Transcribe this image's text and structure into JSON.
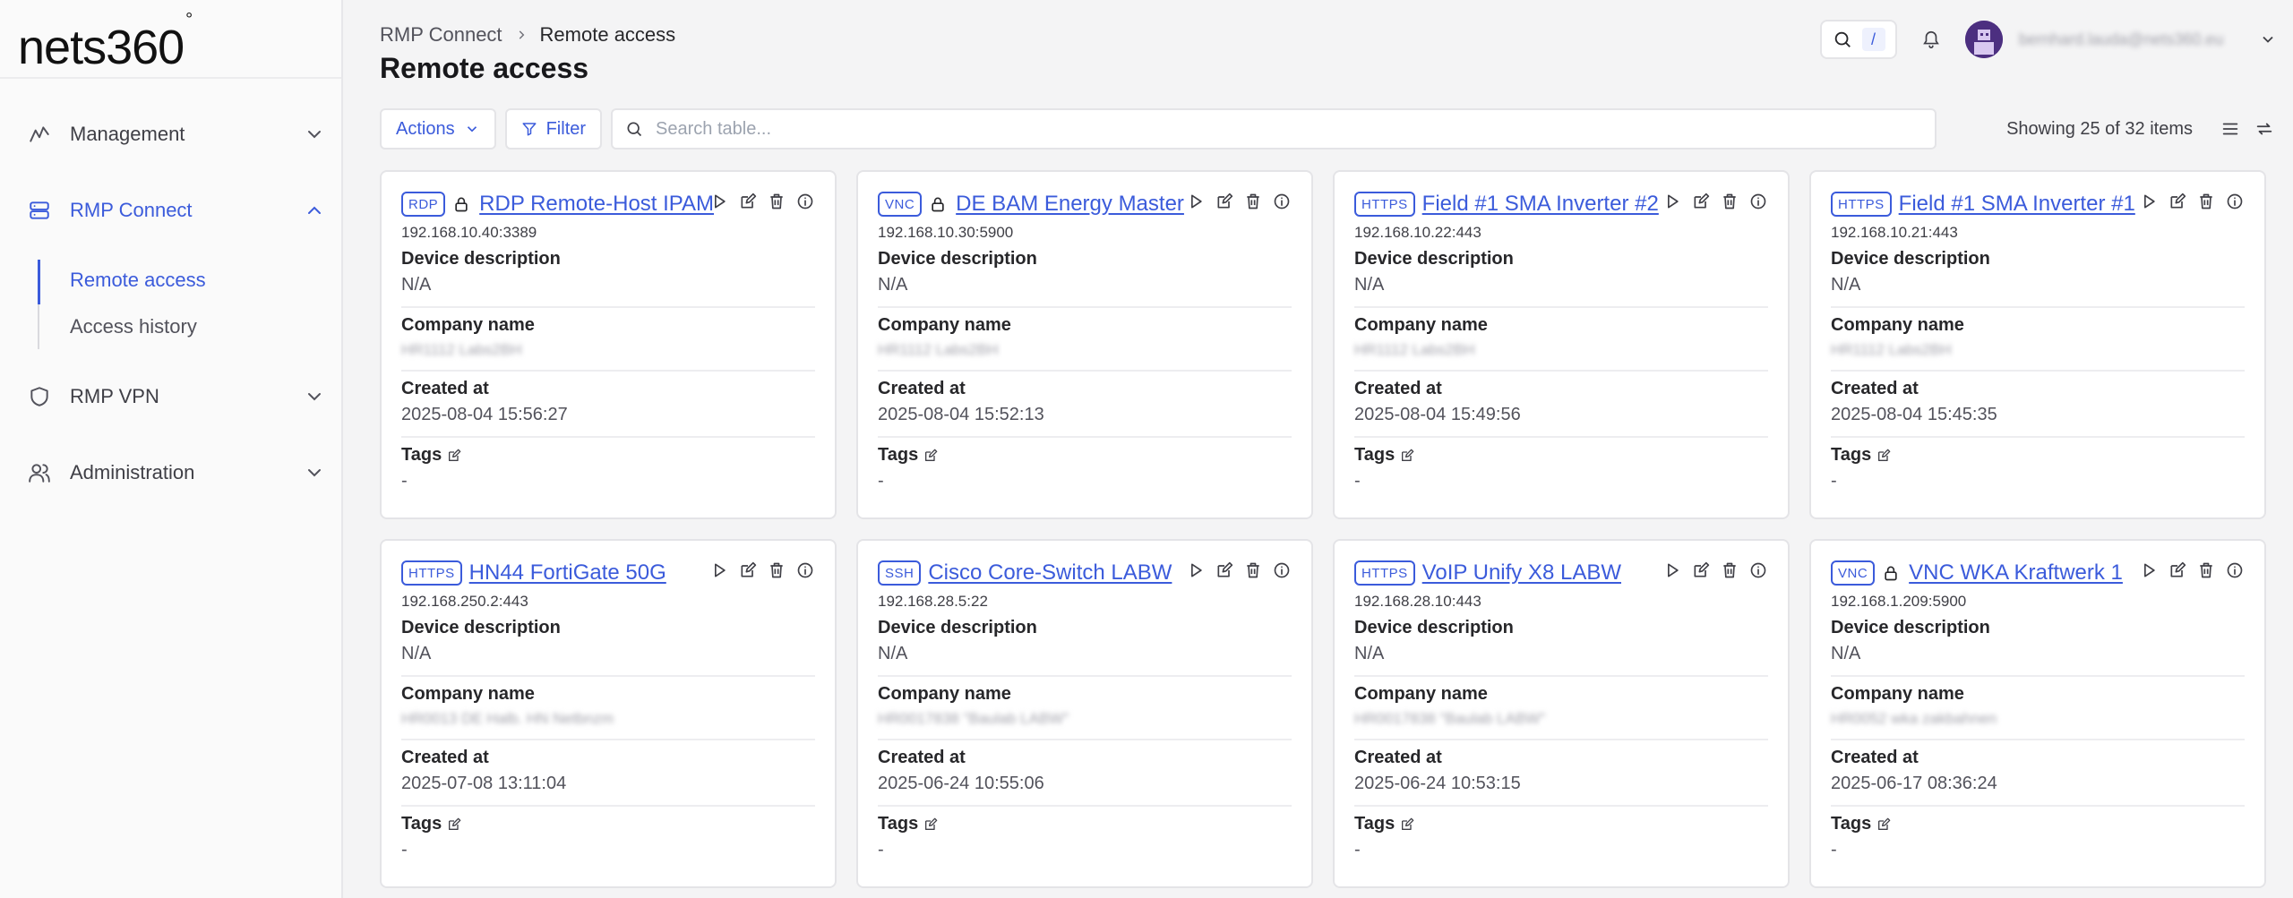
{
  "brand": {
    "logo": "nets360",
    "logo_mark": "°"
  },
  "sidebar": {
    "items": [
      {
        "label": "Management"
      },
      {
        "label": "RMP Connect"
      },
      {
        "label": "RMP VPN"
      },
      {
        "label": "Administration"
      }
    ],
    "subitems": [
      {
        "label": "Remote access"
      },
      {
        "label": "Access history"
      }
    ]
  },
  "breadcrumb": {
    "parent": "RMP Connect",
    "current": "Remote access"
  },
  "page": {
    "title": "Remote access"
  },
  "header": {
    "shortcut_key": "/",
    "user_email": "bernhard.lauda@nets360.eu"
  },
  "toolbar": {
    "actions_label": "Actions",
    "filter_label": "Filter",
    "search_placeholder": "Search table...",
    "showing_text": "Showing 25 of 32 items"
  },
  "labels": {
    "device_description": "Device description",
    "company_name": "Company name",
    "created_at": "Created at",
    "tags": "Tags"
  },
  "colors": {
    "accent": "#3b5bdb",
    "card_border": "#e4e4e7",
    "background": "#f4f4f5"
  },
  "cards": [
    {
      "protocol": "RDP",
      "locked": true,
      "title": "RDP Remote-Host IPAM",
      "address": "192.168.10.40:3389",
      "description": "N/A",
      "company": "HR1112 Labs2BH",
      "created": "2025-08-04 15:56:27",
      "tags": "-"
    },
    {
      "protocol": "VNC",
      "locked": true,
      "title": "DE BAM Energy Master",
      "address": "192.168.10.30:5900",
      "description": "N/A",
      "company": "HR1112 Labs2BH",
      "created": "2025-08-04 15:52:13",
      "tags": "-"
    },
    {
      "protocol": "HTTPS",
      "locked": false,
      "title": "Field #1 SMA Inverter #2",
      "address": "192.168.10.22:443",
      "description": "N/A",
      "company": "HR1112 Labs2BH",
      "created": "2025-08-04 15:49:56",
      "tags": "-"
    },
    {
      "protocol": "HTTPS",
      "locked": false,
      "title": "Field #1 SMA Inverter #1",
      "address": "192.168.10.21:443",
      "description": "N/A",
      "company": "HR1112 Labs2BH",
      "created": "2025-08-04 15:45:35",
      "tags": "-"
    },
    {
      "protocol": "HTTPS",
      "locked": false,
      "title": "HN44 FortiGate 50G",
      "address": "192.168.250.2:443",
      "description": "N/A",
      "company": "HR0013 DE Halb. HN Netbnzm",
      "created": "2025-07-08 13:11:04",
      "tags": "-"
    },
    {
      "protocol": "SSH",
      "locked": false,
      "title": "Cisco Core-Switch LABW",
      "address": "192.168.28.5:22",
      "description": "N/A",
      "company": "HR0017838 \"Baulab LABW\"",
      "created": "2025-06-24 10:55:06",
      "tags": "-"
    },
    {
      "protocol": "HTTPS",
      "locked": false,
      "title": "VoIP Unify X8 LABW",
      "address": "192.168.28.10:443",
      "description": "N/A",
      "company": "HR0017838 \"Baulab LABW\"",
      "created": "2025-06-24 10:53:15",
      "tags": "-"
    },
    {
      "protocol": "VNC",
      "locked": true,
      "title": "VNC WKA Kraftwerk 1",
      "address": "192.168.1.209:5900",
      "description": "N/A",
      "company": "HR0052 wka zakbahnen",
      "created": "2025-06-17 08:36:24",
      "tags": "-"
    }
  ]
}
